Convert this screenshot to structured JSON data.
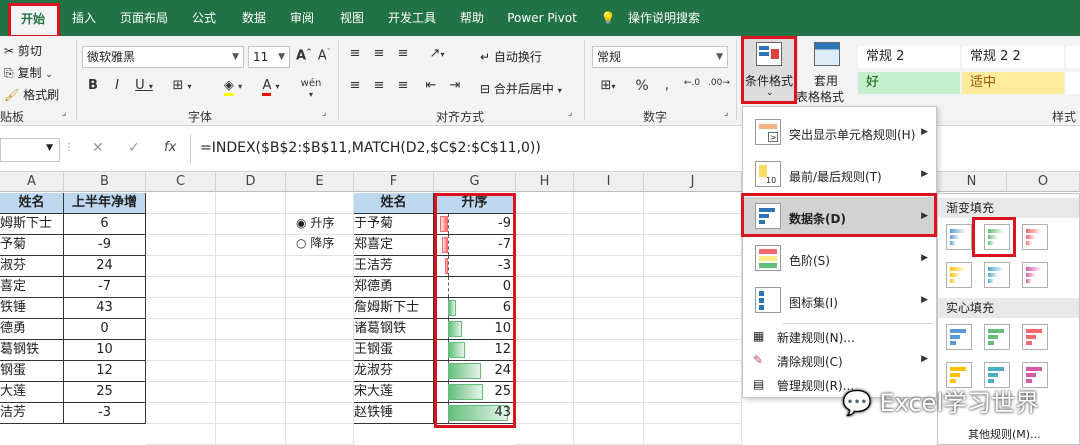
{
  "tabs": [
    "开始",
    "插入",
    "页面布局",
    "公式",
    "数据",
    "审阅",
    "视图",
    "开发工具",
    "帮助",
    "Power Pivot",
    "操作说明搜索"
  ],
  "clipboard": {
    "cut": "剪切",
    "copy": "复制",
    "format_painter": "格式刷",
    "label": "贴板"
  },
  "font": {
    "name": "微软雅黑",
    "size": "11",
    "label": "字体"
  },
  "alignment": {
    "wrap": "自动换行",
    "merge": "合并后居中",
    "label": "对齐方式"
  },
  "number": {
    "format": "常规",
    "label": "数字"
  },
  "styles": {
    "cond_format": "条件格式",
    "table_format_1": "套用",
    "table_format_2": "表格格式",
    "normal2": "常规 2",
    "normal22": "常规 2 2",
    "good": "好",
    "neutral": "适中",
    "label": "样式"
  },
  "formula_bar": {
    "fx": "fx",
    "formula": "=INDEX($B$2:$B$11,MATCH(D2,$C$2:$C$11,0))"
  },
  "columns": [
    "A",
    "B",
    "C",
    "D",
    "E",
    "F",
    "G",
    "H",
    "I",
    "J",
    "N",
    "O"
  ],
  "left_table": {
    "headers": [
      "姓名",
      "上半年净增"
    ],
    "rows": [
      [
        "姆斯下士",
        "6"
      ],
      [
        "予菊",
        "-9"
      ],
      [
        "淑芬",
        "24"
      ],
      [
        "喜定",
        "-7"
      ],
      [
        "铁锤",
        "43"
      ],
      [
        "德勇",
        "0"
      ],
      [
        "葛钢铁",
        "10"
      ],
      [
        "钢蛋",
        "12"
      ],
      [
        "大莲",
        "25"
      ],
      [
        "洁芳",
        "-3"
      ]
    ]
  },
  "radios": {
    "asc": "升序",
    "desc": "降序"
  },
  "right_table": {
    "headers": [
      "姓名",
      "升序"
    ],
    "rows": [
      {
        "name": "于予菊",
        "value": -9
      },
      {
        "name": "郑喜定",
        "value": -7
      },
      {
        "name": "王洁芳",
        "value": -3
      },
      {
        "name": "郑德勇",
        "value": 0
      },
      {
        "name": "詹姆斯下士",
        "value": 6
      },
      {
        "name": "诸葛钢铁",
        "value": 10
      },
      {
        "name": "王钢蛋",
        "value": 12
      },
      {
        "name": "龙淑芬",
        "value": 24
      },
      {
        "name": "宋大莲",
        "value": 25
      },
      {
        "name": "赵铁锤",
        "value": 43
      }
    ]
  },
  "menu": {
    "highlight": "突出显示单元格规则(H)",
    "topbottom": "最前/最后规则(T)",
    "databar": "数据条(D)",
    "colorscale": "色阶(S)",
    "iconset": "图标集(I)",
    "new_rule": "新建规则(N)...",
    "clear_rule": "清除规则(C)",
    "manage_rule": "管理规则(R)..."
  },
  "submenu": {
    "gradient": "渐变填充",
    "solid": "实心填充",
    "other": "其他规则(M)..."
  },
  "watermark": "Excel学习世界",
  "colors": {
    "accent": "#217346",
    "highlight_red": "#d9141f",
    "header_blue": "#bdd7ee",
    "bar_green": "#63be7b",
    "bar_red": "#f8696b"
  }
}
